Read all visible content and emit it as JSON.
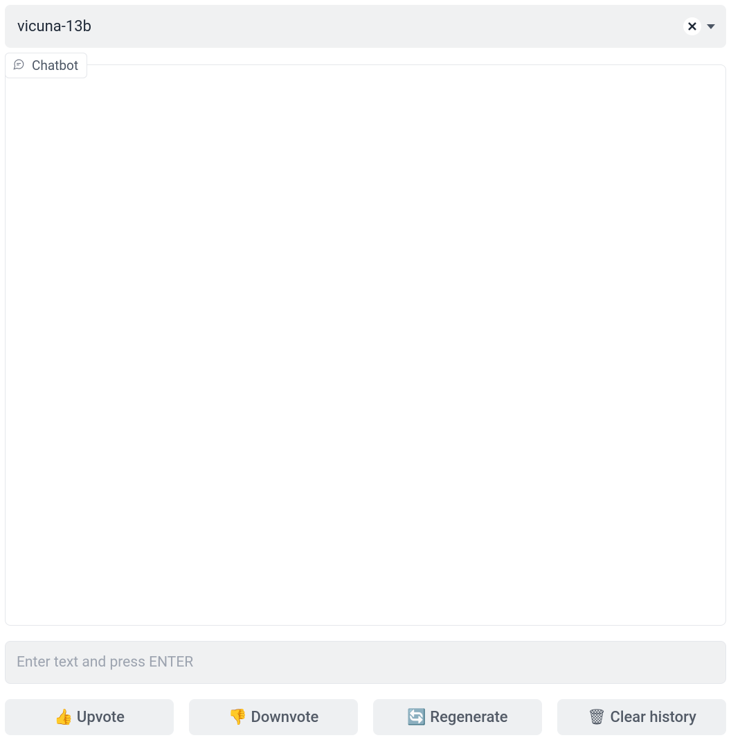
{
  "model_selector": {
    "value": "vicuna-13b"
  },
  "chat": {
    "label": "Chatbot"
  },
  "input": {
    "placeholder": "Enter text and press ENTER"
  },
  "buttons": {
    "upvote": "👍  Upvote",
    "downvote": "👎  Downvote",
    "regenerate": "🔄  Regenerate",
    "clear": "🗑  Clear history"
  }
}
